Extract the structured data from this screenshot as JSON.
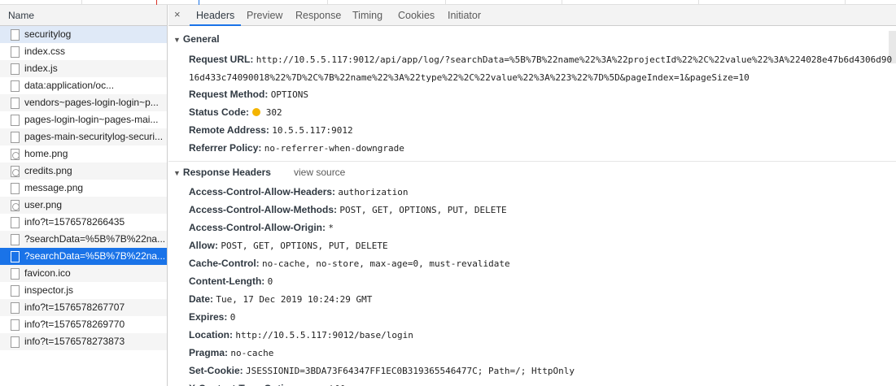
{
  "list": {
    "header": "Name",
    "items": [
      {
        "label": "securitylog",
        "state": "hl"
      },
      {
        "label": "index.css",
        "state": ""
      },
      {
        "label": "index.js",
        "state": "alt"
      },
      {
        "label": "data:application/oc...",
        "state": ""
      },
      {
        "label": "vendors~pages-login-login~p...",
        "state": "alt"
      },
      {
        "label": "pages-login-login~pages-mai...",
        "state": ""
      },
      {
        "label": "pages-main-securitylog-securi...",
        "state": "alt"
      },
      {
        "label": "home.png",
        "state": "",
        "icon": "round"
      },
      {
        "label": "credits.png",
        "state": "alt",
        "icon": "round"
      },
      {
        "label": "message.png",
        "state": ""
      },
      {
        "label": "user.png",
        "state": "alt",
        "icon": "round"
      },
      {
        "label": "info?t=1576578266435",
        "state": ""
      },
      {
        "label": "?searchData=%5B%7B%22na...",
        "state": "alt"
      },
      {
        "label": "?searchData=%5B%7B%22na...",
        "state": "sel"
      },
      {
        "label": "favicon.ico",
        "state": "alt"
      },
      {
        "label": "inspector.js",
        "state": ""
      },
      {
        "label": "info?t=1576578267707",
        "state": "alt"
      },
      {
        "label": "info?t=1576578269770",
        "state": ""
      },
      {
        "label": "info?t=1576578273873",
        "state": "alt"
      }
    ]
  },
  "tabs": {
    "close": "×",
    "headers": "Headers",
    "preview": "Preview",
    "response": "Response",
    "timing": "Timing",
    "cookies": "Cookies",
    "initiator": "Initiator"
  },
  "general": {
    "title": "General",
    "request_url_key": "Request URL:",
    "request_url_line1": "http://10.5.5.117:9012/api/app/log/?searchData=%5B%7B%22name%22%3A%22projectId%22%2C%22value%22%3A%224028e47b6d4306d90",
    "request_url_line2": "16d433c74090018%22%7D%2C%7B%22name%22%3A%22type%22%2C%22value%22%3A%223%22%7D%5D&pageIndex=1&pageSize=10",
    "method_key": "Request Method:",
    "method_val": "OPTIONS",
    "status_key": "Status Code:",
    "status_val": "302",
    "status_color": "#f4b400",
    "remote_key": "Remote Address:",
    "remote_val": "10.5.5.117:9012",
    "referrer_key": "Referrer Policy:",
    "referrer_val": "no-referrer-when-downgrade"
  },
  "response_headers": {
    "title": "Response Headers",
    "view_source": "view source",
    "rows": [
      {
        "k": "Access-Control-Allow-Headers:",
        "v": "authorization"
      },
      {
        "k": "Access-Control-Allow-Methods:",
        "v": "POST, GET, OPTIONS, PUT, DELETE"
      },
      {
        "k": "Access-Control-Allow-Origin:",
        "v": "*"
      },
      {
        "k": "Allow:",
        "v": "POST, GET, OPTIONS, PUT, DELETE"
      },
      {
        "k": "Cache-Control:",
        "v": "no-cache, no-store, max-age=0, must-revalidate"
      },
      {
        "k": "Content-Length:",
        "v": "0"
      },
      {
        "k": "Date:",
        "v": "Tue, 17 Dec 2019 10:24:29 GMT"
      },
      {
        "k": "Expires:",
        "v": "0"
      },
      {
        "k": "Location:",
        "v": "http://10.5.5.117:9012/base/login"
      },
      {
        "k": "Pragma:",
        "v": "no-cache"
      },
      {
        "k": "Set-Cookie:",
        "v": "JSESSIONID=3BDA73F64347FF1EC0B319365546477C; Path=/; HttpOnly"
      },
      {
        "k": "X-Content-Type-Options:",
        "v": "nosniff"
      }
    ]
  }
}
